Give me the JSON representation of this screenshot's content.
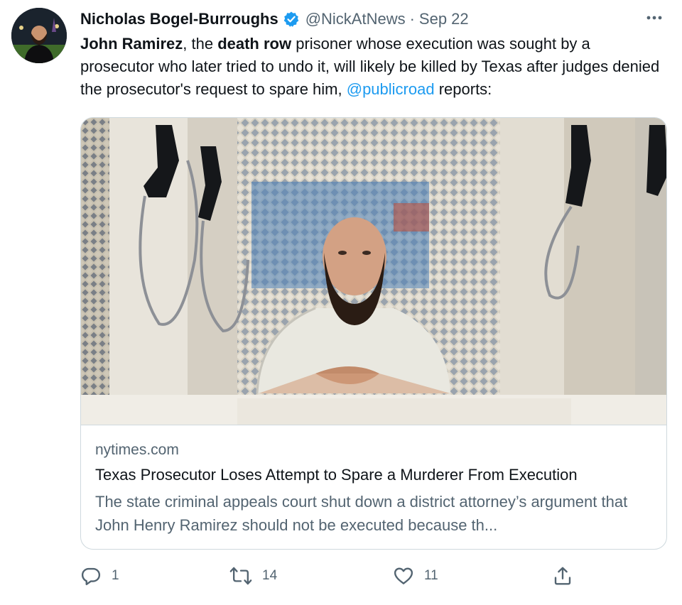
{
  "tweet": {
    "author_name": "Nicholas Bogel-Burroughs",
    "handle": "@NickAtNews",
    "separator": "·",
    "date": "Sep 22",
    "text_parts": {
      "p1": "John Ramirez",
      "p2": ", the ",
      "p3": "death row",
      "p4": " prisoner whose execution was sought by a prosecutor who later tried to undo it, will likely be killed by Texas after judges denied the prosecutor's request to spare him, ",
      "mention": "@publicroad",
      "p5": " reports:"
    }
  },
  "card": {
    "domain": "nytimes.com",
    "title": "Texas Prosecutor Loses Attempt to Spare a Murderer From Execution",
    "description": "The state criminal appeals court shut down a district attorney’s argument that John Henry Ramirez should not be executed because th..."
  },
  "actions": {
    "reply_count": "1",
    "retweet_count": "14",
    "like_count": "11"
  },
  "colors": {
    "accent": "#1d9bf0",
    "secondary_text": "#536471",
    "primary_text": "#0f1419",
    "border": "#cfd9de"
  },
  "icons": [
    "verified-badge-icon",
    "more-icon",
    "reply-icon",
    "retweet-icon",
    "like-icon",
    "share-icon"
  ]
}
